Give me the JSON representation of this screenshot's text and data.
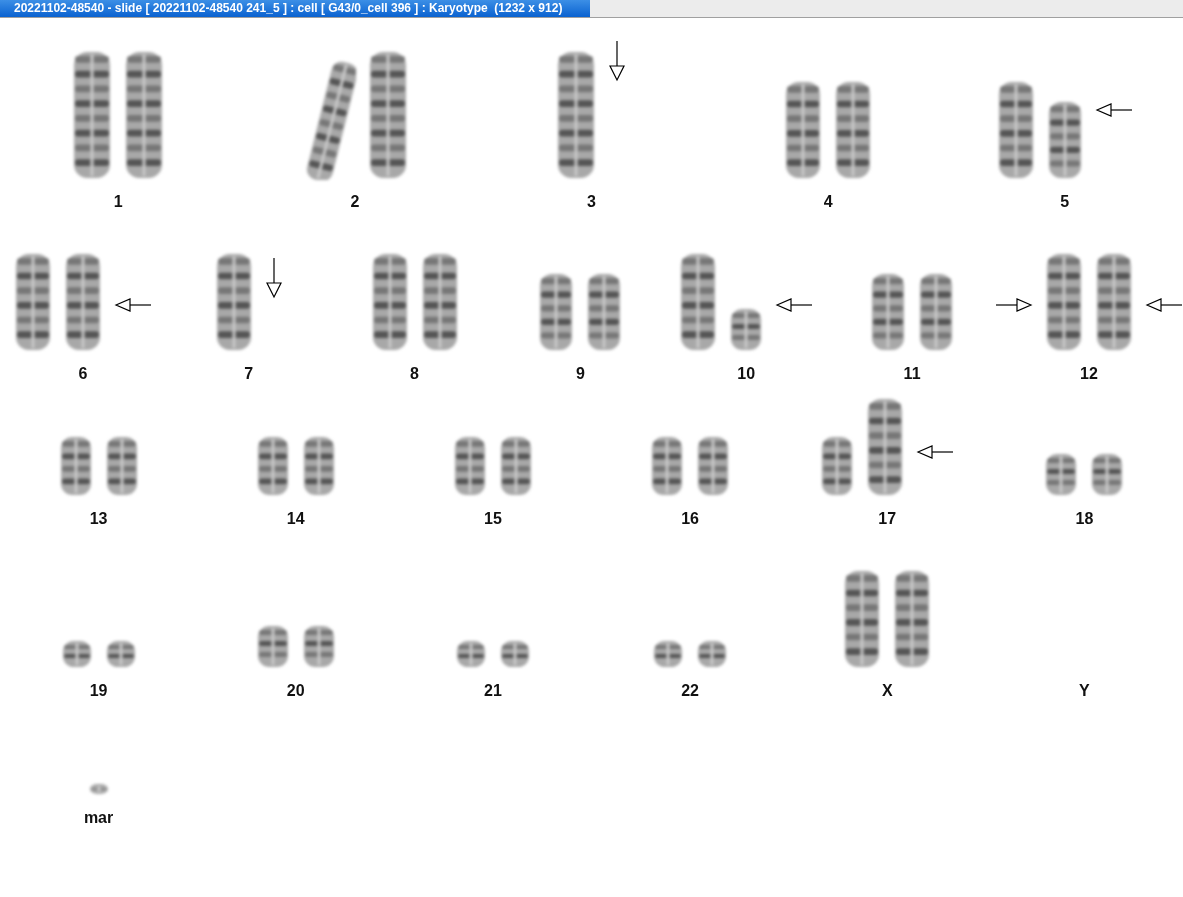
{
  "window": {
    "title": "20221102-48540 - slide [ 20221102-48540 241_5 ] : cell [ G43/0_cell 396 ] : Karyotype  (1232 x 912)"
  },
  "rows": [
    {
      "slots": [
        {
          "label": "1",
          "chromosomes": [
            {
              "kind": "long"
            },
            {
              "kind": "long"
            }
          ]
        },
        {
          "label": "2",
          "chromosomes": [
            {
              "kind": "bent"
            },
            {
              "kind": "long"
            }
          ]
        },
        {
          "label": "3",
          "chromosomes": [
            {
              "kind": "long"
            }
          ],
          "arrows": [
            {
              "kind": "down"
            }
          ]
        },
        {
          "label": "4",
          "chromosomes": [
            {
              "kind": "large"
            },
            {
              "kind": "large"
            }
          ]
        },
        {
          "label": "5",
          "chromosomes": [
            {
              "kind": "large"
            },
            {
              "kind": "medium"
            }
          ],
          "arrows": [
            {
              "kind": "left"
            }
          ]
        }
      ]
    },
    {
      "slots": [
        {
          "label": "6",
          "chromosomes": [
            {
              "kind": "large"
            },
            {
              "kind": "large"
            }
          ],
          "arrows": [
            {
              "kind": "left"
            }
          ]
        },
        {
          "label": "7",
          "chromosomes": [
            {
              "kind": "large"
            }
          ],
          "arrows": [
            {
              "kind": "down"
            }
          ]
        },
        {
          "label": "8",
          "chromosomes": [
            {
              "kind": "large"
            },
            {
              "kind": "large"
            }
          ]
        },
        {
          "label": "9",
          "chromosomes": [
            {
              "kind": "medium"
            },
            {
              "kind": "medium"
            }
          ]
        },
        {
          "label": "10",
          "chromosomes": [
            {
              "kind": "large"
            },
            {
              "kind": "short"
            }
          ],
          "arrows": [
            {
              "kind": "left"
            }
          ]
        },
        {
          "label": "11",
          "chromosomes": [
            {
              "kind": "medium"
            },
            {
              "kind": "medium"
            }
          ]
        },
        {
          "label": "12",
          "chromosomes": [
            {
              "kind": "large"
            },
            {
              "kind": "large"
            }
          ],
          "arrows": [
            {
              "kind": "right"
            },
            {
              "kind": "left"
            }
          ]
        }
      ]
    },
    {
      "slots": [
        {
          "label": "13",
          "chromosomes": [
            {
              "kind": "small"
            },
            {
              "kind": "small"
            }
          ]
        },
        {
          "label": "14",
          "chromosomes": [
            {
              "kind": "small"
            },
            {
              "kind": "small"
            }
          ]
        },
        {
          "label": "15",
          "chromosomes": [
            {
              "kind": "small"
            },
            {
              "kind": "small"
            }
          ]
        },
        {
          "label": "16",
          "chromosomes": [
            {
              "kind": "small"
            },
            {
              "kind": "small"
            }
          ]
        },
        {
          "label": "17",
          "chromosomes": [
            {
              "kind": "small"
            },
            {
              "kind": "large"
            }
          ],
          "arrows": [
            {
              "kind": "left"
            }
          ]
        },
        {
          "label": "18",
          "chromosomes": [
            {
              "kind": "short"
            },
            {
              "kind": "short"
            }
          ]
        }
      ]
    },
    {
      "slots": [
        {
          "label": "19",
          "chromosomes": [
            {
              "kind": "tiny"
            },
            {
              "kind": "tiny"
            }
          ]
        },
        {
          "label": "20",
          "chromosomes": [
            {
              "kind": "short"
            },
            {
              "kind": "short"
            }
          ]
        },
        {
          "label": "21",
          "chromosomes": [
            {
              "kind": "tiny"
            },
            {
              "kind": "tiny"
            }
          ]
        },
        {
          "label": "22",
          "chromosomes": [
            {
              "kind": "tiny"
            },
            {
              "kind": "tiny"
            }
          ]
        },
        {
          "label": "X",
          "chromosomes": [
            {
              "kind": "large"
            },
            {
              "kind": "large"
            }
          ]
        },
        {
          "label": "Y"
        }
      ]
    },
    {
      "slots": [
        {
          "label": "mar",
          "chromosomes": [
            {
              "kind": "dot"
            }
          ]
        }
      ]
    }
  ]
}
